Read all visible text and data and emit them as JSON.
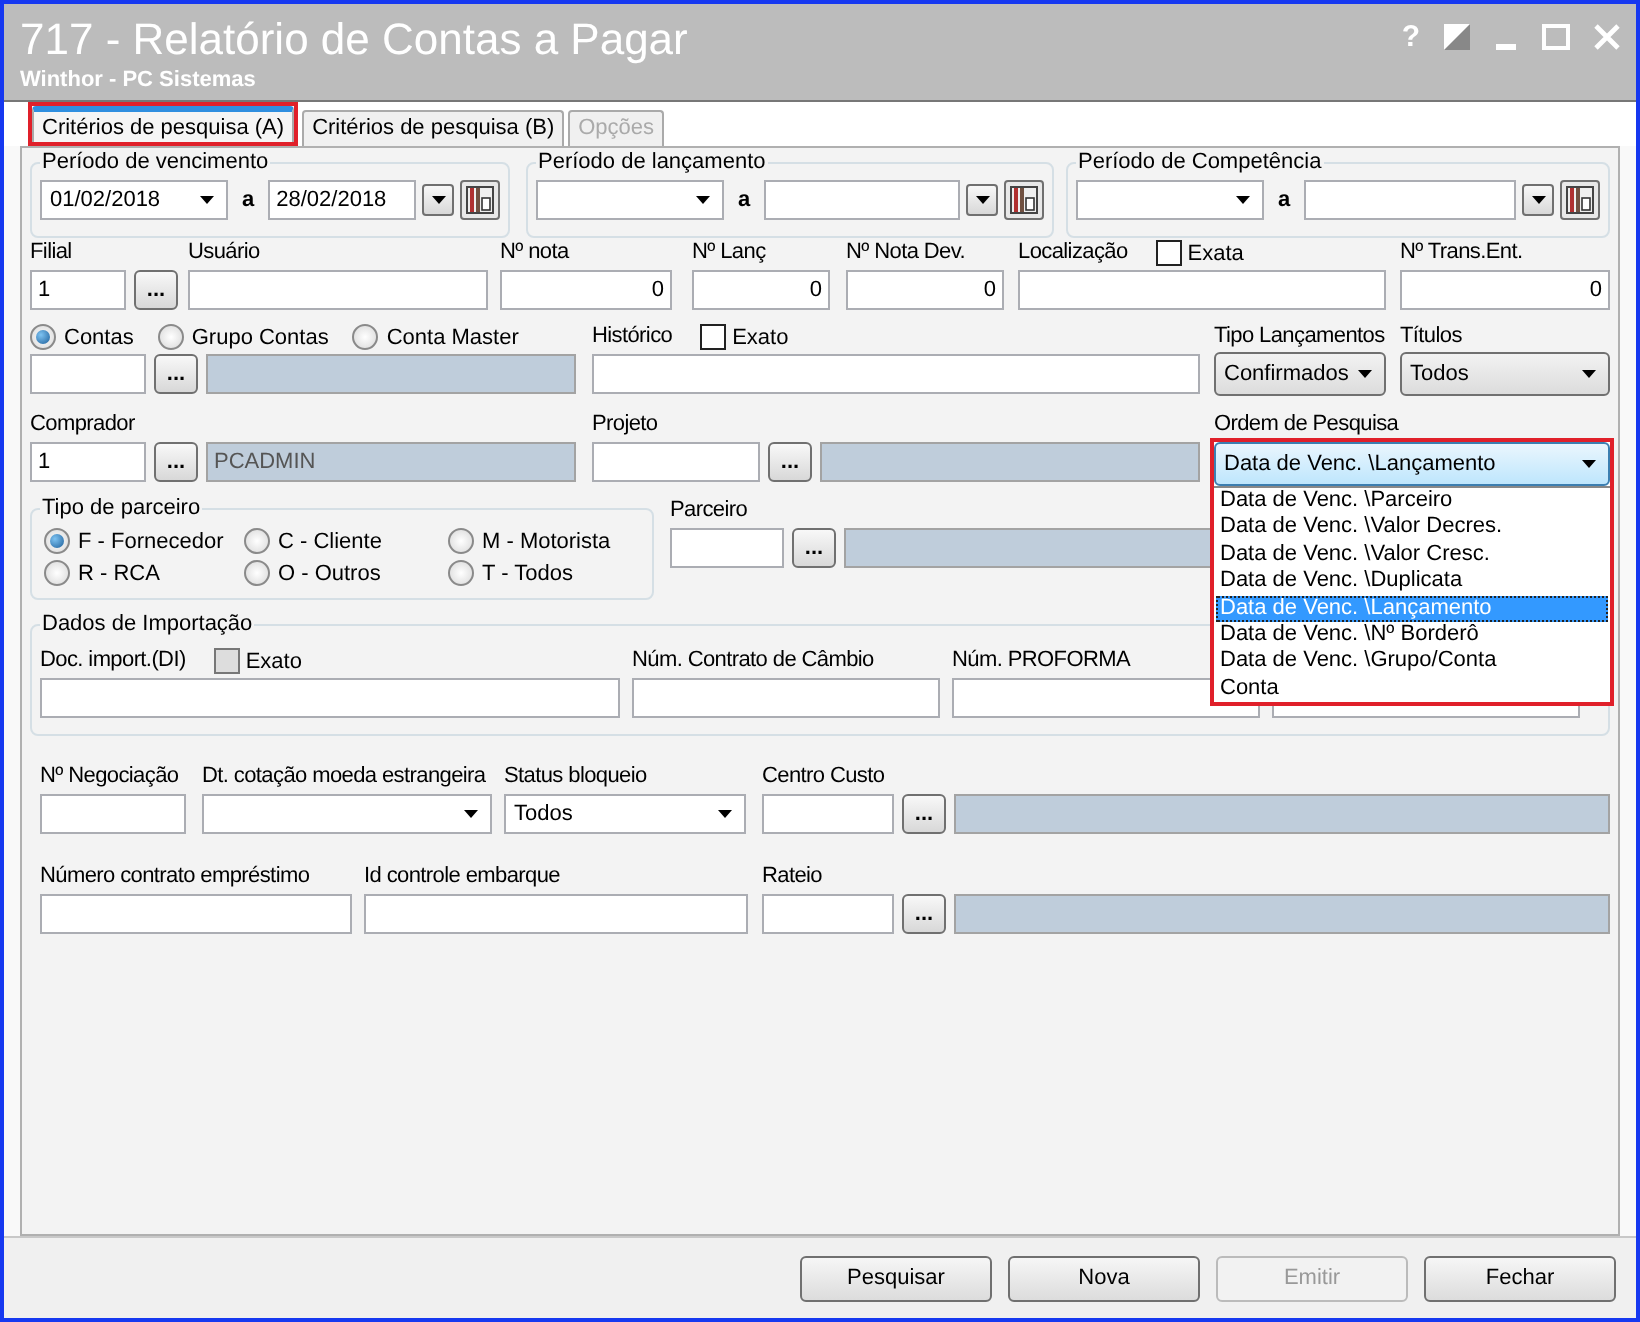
{
  "window": {
    "title": "717 - Relatório de Contas a Pagar",
    "subtitle": "Winthor - PC Sistemas",
    "help": "?"
  },
  "tabs": [
    {
      "label": "Critérios de pesquisa (A)",
      "selected": true,
      "disabled": false,
      "highlighted": true
    },
    {
      "label": "Critérios de pesquisa (B)",
      "selected": false,
      "disabled": false,
      "highlighted": false
    },
    {
      "label": "Opções",
      "selected": false,
      "disabled": true,
      "highlighted": false
    }
  ],
  "rows": [
    [
      {
        "kind": "period",
        "title": "Período de vencimento",
        "from": "01/02/2018",
        "separator": "a",
        "to": "28/02/2018"
      },
      {
        "kind": "period",
        "title": "Período de lançamento",
        "separator": "a"
      },
      {
        "kind": "period",
        "title": "Período de Competência",
        "separator": "a"
      }
    ],
    [
      {
        "kind": "lookup",
        "label": "Filial",
        "value": "1",
        "browse": "..."
      },
      {
        "kind": "text",
        "label": "Usuário"
      },
      {
        "kind": "number",
        "label": "Nº nota",
        "value": "0"
      },
      {
        "kind": "number",
        "label": "Nº Lanç",
        "value": "0"
      },
      {
        "kind": "number",
        "label": "Nº Nota Dev.",
        "value": "0"
      },
      {
        "kind": "text",
        "label": "Localização",
        "checkbox": {
          "label": "Exata",
          "checked": false,
          "disabled": false
        }
      },
      {
        "kind": "number",
        "label": "Nº Trans.Ent.",
        "value": "0"
      }
    ],
    [
      {
        "kind": "lookup_desc",
        "radios": [
          {
            "label": "Contas",
            "selected": true
          },
          {
            "label": "Grupo Contas",
            "selected": false
          },
          {
            "label": "Conta Master",
            "selected": false
          }
        ],
        "browse": "..."
      },
      {
        "kind": "text",
        "label": "Histórico",
        "checkbox": {
          "label": "Exato",
          "checked": false,
          "disabled": false
        }
      },
      {
        "kind": "select",
        "label": "Tipo Lançamentos",
        "value": "Confirmados"
      },
      {
        "kind": "select",
        "label": "Títulos",
        "value": "Todos"
      }
    ],
    [
      {
        "kind": "lookup_desc",
        "label": "Comprador",
        "value": "1",
        "browse": "...",
        "description": "PCADMIN"
      },
      {
        "kind": "lookup_desc",
        "label": "Projeto",
        "browse": "..."
      },
      {
        "kind": "select",
        "label": "Ordem de Pesquisa",
        "value": "Data de Venc. \\Lançamento",
        "expanded": true,
        "highlighted": true,
        "options": [
          {
            "label": "Data de Venc. \\Parceiro",
            "selected": false
          },
          {
            "label": "Data de Venc. \\Valor Decres.",
            "selected": false
          },
          {
            "label": "Data de Venc. \\Valor Cresc.",
            "selected": false
          },
          {
            "label": "Data de Venc. \\Duplicata",
            "selected": false
          },
          {
            "label": "Data de Venc. \\Lançamento",
            "selected": true
          },
          {
            "label": "Data de Venc. \\Nº Borderô",
            "selected": false
          },
          {
            "label": "Data de Venc. \\Grupo/Conta",
            "selected": false
          },
          {
            "label": "Conta",
            "selected": false
          }
        ]
      }
    ],
    [
      {
        "kind": "radio_group",
        "title": "Tipo de parceiro",
        "options": [
          {
            "label": "F - Fornecedor",
            "selected": true
          },
          {
            "label": "C - Cliente",
            "selected": false
          },
          {
            "label": "M - Motorista",
            "selected": false
          },
          {
            "label": "R - RCA",
            "selected": false
          },
          {
            "label": "O - Outros",
            "selected": false
          },
          {
            "label": "T - Todos",
            "selected": false
          }
        ]
      },
      {
        "kind": "lookup_desc",
        "label": "Parceiro",
        "browse": "..."
      }
    ],
    [
      {
        "kind": "group",
        "title": "Dados de Importação",
        "fields": [
          {
            "kind": "text",
            "label": "Doc. import.(DI)",
            "checkbox": {
              "label": "Exato",
              "checked": false,
              "disabled": true
            }
          },
          {
            "kind": "text",
            "label": "Núm. Contrato de Câmbio"
          },
          {
            "kind": "text",
            "label": "Núm. PROFORMA"
          },
          {
            "kind": "text"
          }
        ]
      }
    ],
    [
      {
        "kind": "text",
        "label": "Nº Negociação"
      },
      {
        "kind": "select",
        "label": "Dt. cotação moeda estrangeira"
      },
      {
        "kind": "select",
        "label": "Status bloqueio",
        "value": "Todos"
      },
      {
        "kind": "lookup_desc",
        "label": "Centro Custo",
        "browse": "..."
      }
    ],
    [
      {
        "kind": "text",
        "label": "Número contrato empréstimo"
      },
      {
        "kind": "text",
        "label": "Id controle embarque"
      },
      {
        "kind": "lookup_desc",
        "label": "Rateio",
        "browse": "..."
      }
    ]
  ],
  "buttons": [
    {
      "label": "Pesquisar",
      "disabled": false
    },
    {
      "label": "Nova",
      "disabled": false
    },
    {
      "label": "Emitir",
      "disabled": true
    },
    {
      "label": "Fechar",
      "disabled": false
    }
  ]
}
